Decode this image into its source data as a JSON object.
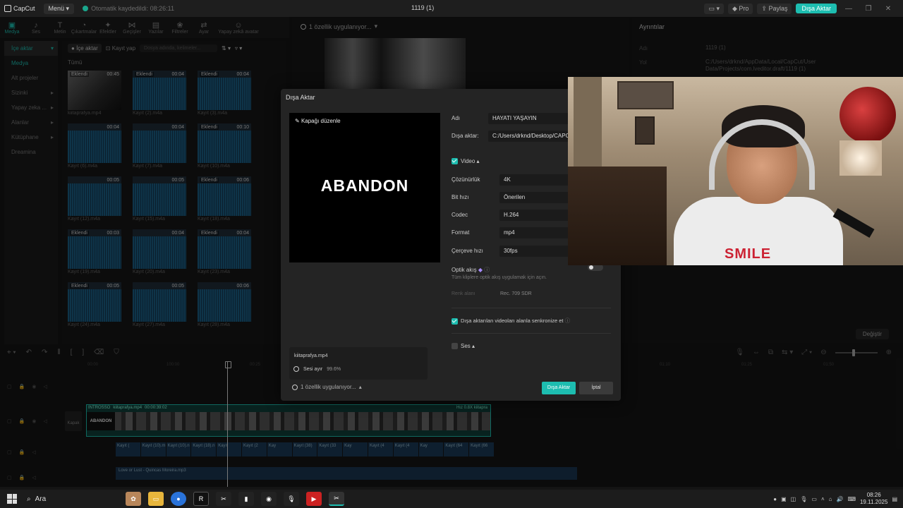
{
  "titlebar": {
    "logo": "CapCut",
    "menu": "Menü",
    "saved": "Otomatik kaydedildi: 08:26:11",
    "project": "1119 (1)",
    "pro": "Pro",
    "share": "Paylaş",
    "export": "Dışa Aktar"
  },
  "toolbar": [
    "Medya",
    "Ses",
    "Metin",
    "Çıkartmalar",
    "Efektler",
    "Geçişler",
    "Yazılar",
    "Filtreler",
    "Ayar",
    "Yapay zekâ avatar"
  ],
  "sidebar": [
    "İçe aktar",
    "Medya",
    "Alt projeler",
    "Sizinki",
    "Yapay zeka ...",
    "Alanlar",
    "Kütüphane",
    "Dreamina"
  ],
  "media": {
    "import": "İçe aktar",
    "record": "Kayıt yap",
    "search_placeholder": "Dosya adında, kelimeler...",
    "all": "Tümü",
    "items": [
      {
        "tag": "Eklendi",
        "dur": "00:45",
        "name": "kiitaprafya.mp4"
      },
      {
        "tag": "Eklendi",
        "dur": "00:04",
        "name": "Kayıt (2).m4a"
      },
      {
        "tag": "Eklendi",
        "dur": "00:04",
        "name": "Kayıt (3).m4a"
      },
      {
        "tag": "",
        "dur": "00:04",
        "name": "Kayıt (6).m4a"
      },
      {
        "tag": "",
        "dur": "00:04",
        "name": "Kayıt (7).m4a"
      },
      {
        "tag": "Eklendi",
        "dur": "00:10",
        "name": "Kayıt (10).m4a"
      },
      {
        "tag": "",
        "dur": "00:05",
        "name": "Kayıt (12).m4a"
      },
      {
        "tag": "",
        "dur": "00:05",
        "name": "Kayıt (15).m4a"
      },
      {
        "tag": "Eklendi",
        "dur": "00:06",
        "name": "Kayıt (18).m4a"
      },
      {
        "tag": "Eklendi",
        "dur": "00:03",
        "name": "Kayıt (19).m4a"
      },
      {
        "tag": "",
        "dur": "00:04",
        "name": "Kayıt (20).m4a"
      },
      {
        "tag": "Eklendi",
        "dur": "00:04",
        "name": "Kayıt (23).m4a"
      },
      {
        "tag": "Eklendi",
        "dur": "00:05",
        "name": "Kayıt (24).m4a"
      },
      {
        "tag": "",
        "dur": "00:05",
        "name": "Kayıt (27).m4a"
      },
      {
        "tag": "",
        "dur": "00:06",
        "name": "Kayıt (28).m4a"
      }
    ]
  },
  "player": {
    "status": "1 özellik uygulanıyor..."
  },
  "details": {
    "title": "Ayrıntılar",
    "name_label": "Adı",
    "name_value": "1119 (1)",
    "path_label": "Yol",
    "path_value": "C:/Users/drknd/AppData/Local/CapCut/User Data/Projects/com.lveditor.draft/1119 (1)",
    "change": "Değiştir"
  },
  "dialog": {
    "title": "Dışa Aktar",
    "edit_cover": "Kapağı düzenle",
    "preview_text": "ABANDON",
    "name_label": "Adı",
    "name_value": "HAYATI YAŞAYIN",
    "export_to_label": "Dışa aktar:",
    "export_to_value": "C:/Users/drknd/Desktop/CAPCUT",
    "video_label": "Video",
    "resolution_label": "Çözünürlük",
    "resolution_value": "4K",
    "bitrate_label": "Bit hızı",
    "bitrate_value": "Önerilen",
    "codec_label": "Codec",
    "codec_value": "H.264",
    "format_label": "Format",
    "format_value": "mp4",
    "fps_label": "Çerçeve hızı",
    "fps_value": "30fps",
    "optical_label": "Optik akış",
    "optical_desc": "Tüm kliplere optik akış uygulamak için açın.",
    "color_label": "Renk alanı",
    "color_value": "Rec. 709 SDR",
    "sync_label": "Dışa aktarılan videoları alanla senkronize et",
    "audio_label": "Ses",
    "progress_file": "kiitaprafya.mp4",
    "progress_task": "Sesi ayır",
    "progress_value": "99.6%",
    "status": "1 özellik uygulanıyor...",
    "export_btn": "Dışa Aktar",
    "cancel_btn": "İptal"
  },
  "timeline": {
    "cover": "Kapak",
    "clip_head": "INTROSSO",
    "clip_file": "kiitaprafya.mp4",
    "clip_dur": "00:00:39:02",
    "clip_speed": "Hız 0.8X",
    "clip_extra": "kiitapra",
    "abandon": "ABANDON",
    "audio_clips": [
      "Kayıt (",
      "Kayıt (10).m",
      "Kayıt (10).n",
      "Kayıt (18).n",
      "Kayıt",
      "Kayıt (2",
      "Kay",
      "Kayıt (38)",
      "Kayıt (33",
      "Kay",
      "Kayıt (4",
      "Kayıt (4",
      "Kay",
      "Kayıt (64",
      "Kayıt (66"
    ],
    "music": "Love or Lust - Quincas Moreira.mp3",
    "ruler": [
      "00:00",
      "100:00",
      "00:25",
      "01:10",
      "01:25",
      "01:50"
    ]
  },
  "taskbar": {
    "search": "Ara",
    "time": "08:26",
    "date": "19.11.2025"
  }
}
